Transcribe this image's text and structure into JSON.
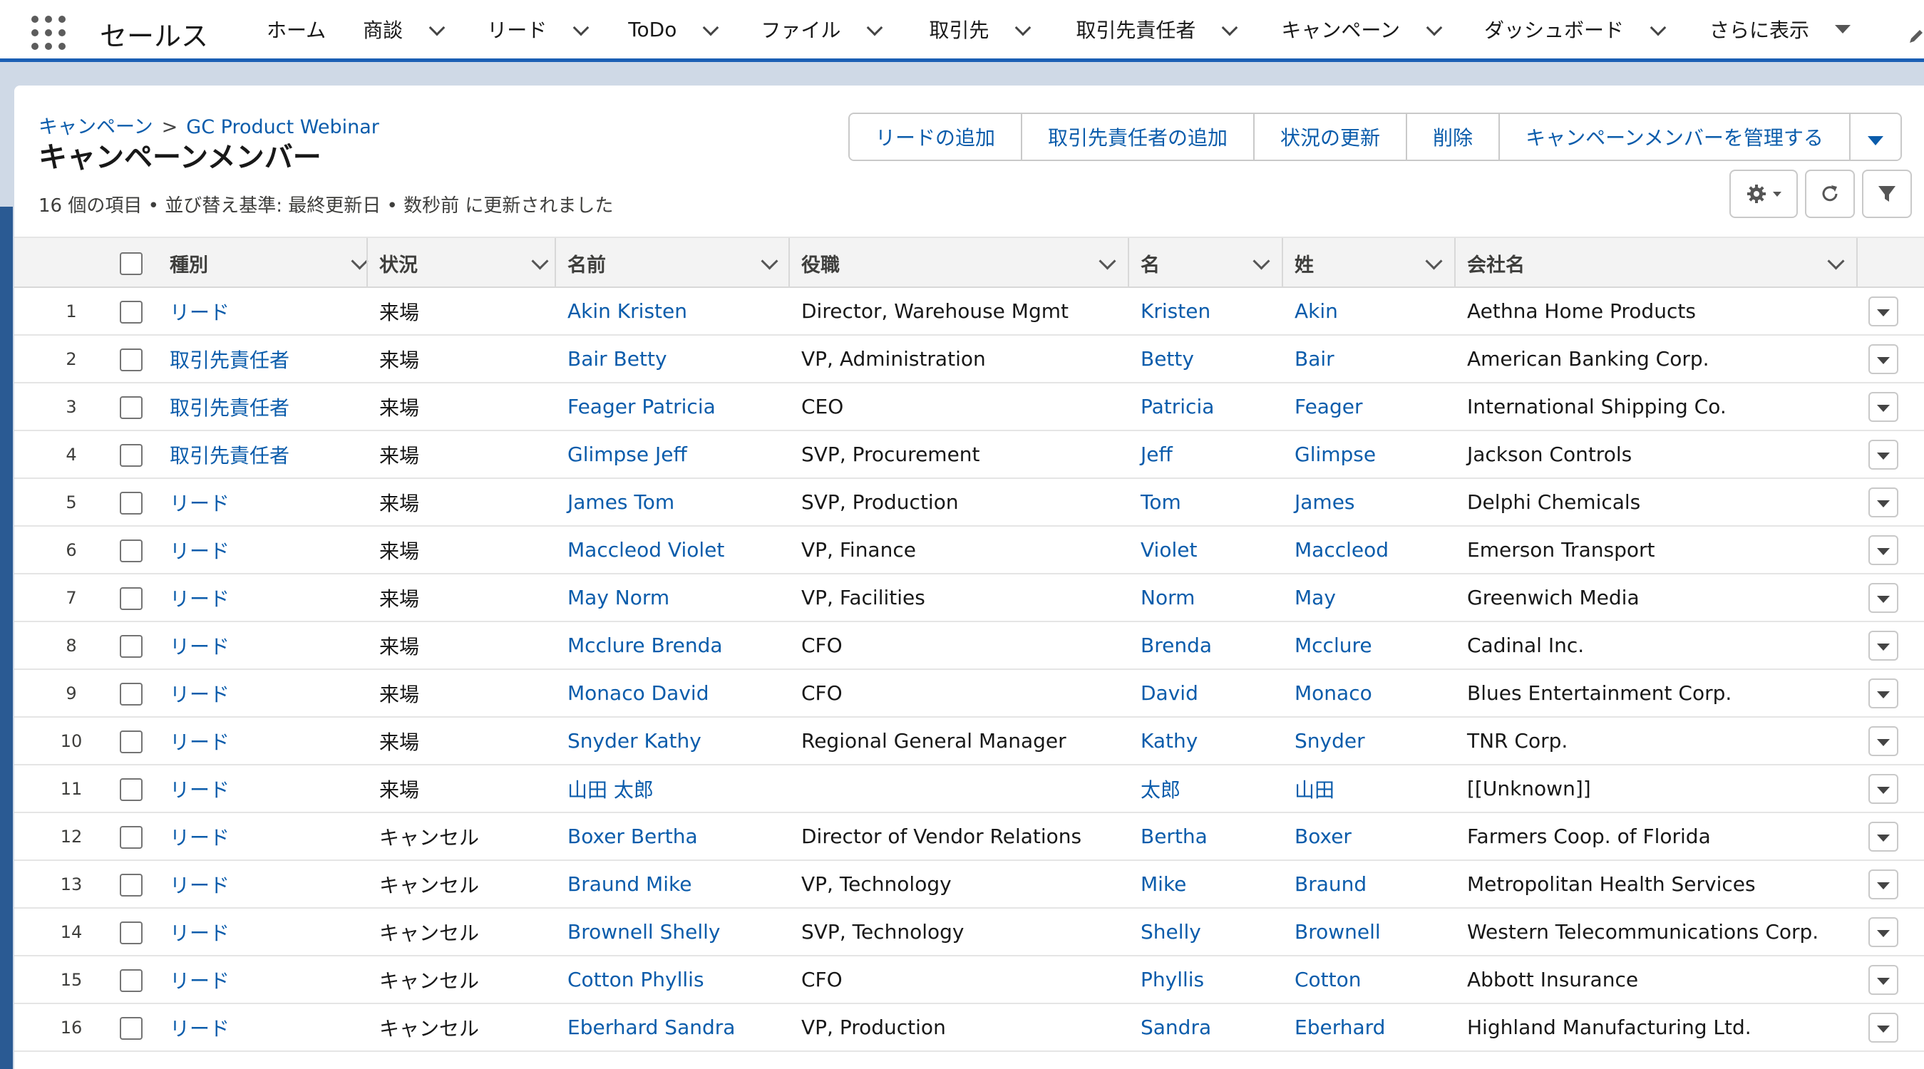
{
  "app": {
    "name": "セールス"
  },
  "nav": {
    "items": [
      {
        "label": "ホーム",
        "dropdown": false
      },
      {
        "label": "商談",
        "dropdown": true
      },
      {
        "label": "リード",
        "dropdown": true
      },
      {
        "label": "ToDo",
        "dropdown": true
      },
      {
        "label": "ファイル",
        "dropdown": true
      },
      {
        "label": "取引先",
        "dropdown": true
      },
      {
        "label": "取引先責任者",
        "dropdown": true
      },
      {
        "label": "キャンペーン",
        "dropdown": true
      },
      {
        "label": "ダッシュボード",
        "dropdown": true
      },
      {
        "label": "さらに表示",
        "dropdown": true
      }
    ]
  },
  "breadcrumb": {
    "parent": "キャンペーン",
    "separator": ">",
    "current": "GC Product Webinar"
  },
  "page": {
    "title": "キャンペーンメンバー",
    "meta": "16 個の項目 • 並び替え基準: 最終更新日 • 数秒前 に更新されました"
  },
  "actions": {
    "add_lead": "リードの追加",
    "add_contact": "取引先責任者の追加",
    "update_status": "状況の更新",
    "delete": "削除",
    "manage_members": "キャンペーンメンバーを管理する"
  },
  "columns": {
    "type": "種別",
    "status": "状況",
    "name": "名前",
    "title": "役職",
    "first": "名",
    "last": "姓",
    "company": "会社名"
  },
  "rows": [
    {
      "n": "1",
      "type": "リード",
      "status": "来場",
      "name": "Akin Kristen",
      "title": "Director, Warehouse Mgmt",
      "first": "Kristen",
      "last": "Akin",
      "company": "Aethna Home Products"
    },
    {
      "n": "2",
      "type": "取引先責任者",
      "status": "来場",
      "name": "Bair Betty",
      "title": "VP, Administration",
      "first": "Betty",
      "last": "Bair",
      "company": "American Banking Corp."
    },
    {
      "n": "3",
      "type": "取引先責任者",
      "status": "来場",
      "name": "Feager Patricia",
      "title": "CEO",
      "first": "Patricia",
      "last": "Feager",
      "company": "International Shipping Co."
    },
    {
      "n": "4",
      "type": "取引先責任者",
      "status": "来場",
      "name": "Glimpse Jeff",
      "title": "SVP, Procurement",
      "first": "Jeff",
      "last": "Glimpse",
      "company": "Jackson Controls"
    },
    {
      "n": "5",
      "type": "リード",
      "status": "来場",
      "name": "James Tom",
      "title": "SVP, Production",
      "first": "Tom",
      "last": "James",
      "company": "Delphi Chemicals"
    },
    {
      "n": "6",
      "type": "リード",
      "status": "来場",
      "name": "Maccleod Violet",
      "title": "VP, Finance",
      "first": "Violet",
      "last": "Maccleod",
      "company": "Emerson Transport"
    },
    {
      "n": "7",
      "type": "リード",
      "status": "来場",
      "name": "May Norm",
      "title": "VP, Facilities",
      "first": "Norm",
      "last": "May",
      "company": "Greenwich Media"
    },
    {
      "n": "8",
      "type": "リード",
      "status": "来場",
      "name": "Mcclure Brenda",
      "title": "CFO",
      "first": "Brenda",
      "last": "Mcclure",
      "company": "Cadinal Inc."
    },
    {
      "n": "9",
      "type": "リード",
      "status": "来場",
      "name": "Monaco David",
      "title": "CFO",
      "first": "David",
      "last": "Monaco",
      "company": "Blues Entertainment Corp."
    },
    {
      "n": "10",
      "type": "リード",
      "status": "来場",
      "name": "Snyder Kathy",
      "title": "Regional General Manager",
      "first": "Kathy",
      "last": "Snyder",
      "company": "TNR Corp."
    },
    {
      "n": "11",
      "type": "リード",
      "status": "来場",
      "name": "山田 太郎",
      "title": "",
      "first": "太郎",
      "last": "山田",
      "company": "[[Unknown]]"
    },
    {
      "n": "12",
      "type": "リード",
      "status": "キャンセル",
      "name": "Boxer Bertha",
      "title": "Director of Vendor Relations",
      "first": "Bertha",
      "last": "Boxer",
      "company": "Farmers Coop. of Florida"
    },
    {
      "n": "13",
      "type": "リード",
      "status": "キャンセル",
      "name": "Braund Mike",
      "title": "VP, Technology",
      "first": "Mike",
      "last": "Braund",
      "company": "Metropolitan Health Services"
    },
    {
      "n": "14",
      "type": "リード",
      "status": "キャンセル",
      "name": "Brownell Shelly",
      "title": "SVP, Technology",
      "first": "Shelly",
      "last": "Brownell",
      "company": "Western Telecommunications Corp."
    },
    {
      "n": "15",
      "type": "リード",
      "status": "キャンセル",
      "name": "Cotton Phyllis",
      "title": "CFO",
      "first": "Phyllis",
      "last": "Cotton",
      "company": "Abbott Insurance"
    },
    {
      "n": "16",
      "type": "リード",
      "status": "キャンセル",
      "name": "Eberhard Sandra",
      "title": "VP, Production",
      "first": "Sandra",
      "last": "Eberhard",
      "company": "Highland Manufacturing Ltd."
    }
  ],
  "icons": {
    "app_launcher": "waffle-icon",
    "settings": "gear-icon",
    "refresh": "refresh-icon",
    "filter": "filter-icon",
    "edit": "pencil-icon",
    "row_menu": "chevron-down-icon"
  },
  "colors": {
    "link": "#0b5cab",
    "nav_accent": "#1b5fb4"
  }
}
